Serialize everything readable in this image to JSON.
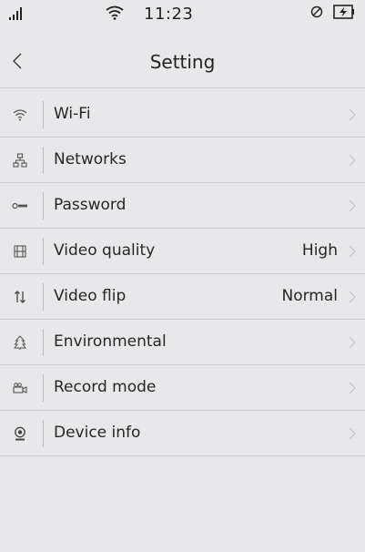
{
  "status_bar": {
    "time": "11:23",
    "signal_icon": "signal-icon",
    "wifi_icon": "wifi-icon",
    "rotation_lock_icon": "rotation-lock-icon",
    "battery_icon": "battery-charging-icon"
  },
  "nav": {
    "title": "Setting",
    "back_icon": "chevron-left-icon"
  },
  "settings": {
    "items": [
      {
        "label": "Wi-Fi",
        "value": "",
        "icon": "wifi-icon"
      },
      {
        "label": "Networks",
        "value": "",
        "icon": "network-icon"
      },
      {
        "label": "Password",
        "value": "",
        "icon": "key-icon"
      },
      {
        "label": "Video quality",
        "value": "High",
        "icon": "film-icon"
      },
      {
        "label": "Video flip",
        "value": "Normal",
        "icon": "flip-arrows-icon"
      },
      {
        "label": "Environmental",
        "value": "",
        "icon": "tree-icon"
      },
      {
        "label": "Record mode",
        "value": "",
        "icon": "video-camera-icon"
      },
      {
        "label": "Device info",
        "value": "",
        "icon": "webcam-icon"
      }
    ]
  },
  "colors": {
    "background": "#e8e8ea",
    "text": "#222222",
    "divider": "#cfcfd2",
    "icon": "#555555",
    "chevron": "#c4c4c8"
  }
}
